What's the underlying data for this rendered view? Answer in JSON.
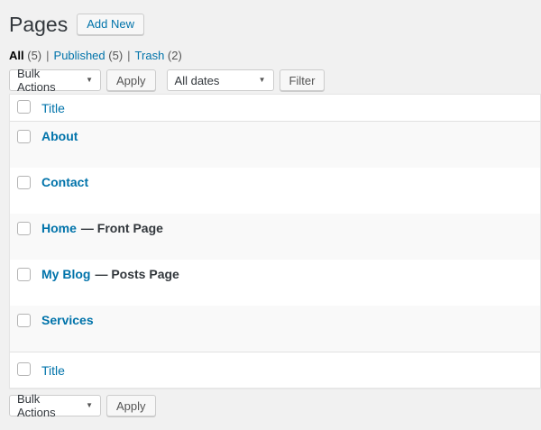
{
  "page": {
    "title": "Pages",
    "add_new_label": "Add New"
  },
  "views": {
    "all_label": "All",
    "all_count": "(5)",
    "published_label": "Published",
    "published_count": "(5)",
    "trash_label": "Trash",
    "trash_count": "(2)",
    "separator": "|"
  },
  "tablenav_top": {
    "bulk_actions_value": "Bulk Actions",
    "apply_label": "Apply",
    "dates_value": "All dates",
    "filter_label": "Filter",
    "dropdown_arrow": "▼"
  },
  "tablenav_bottom": {
    "bulk_actions_value": "Bulk Actions",
    "apply_label": "Apply",
    "dropdown_arrow": "▼"
  },
  "table": {
    "header": {
      "title_column": "Title"
    },
    "footer": {
      "title_column": "Title"
    },
    "rows": [
      {
        "title": "About",
        "state": ""
      },
      {
        "title": "Contact",
        "state": ""
      },
      {
        "title": "Home",
        "state": "— Front Page"
      },
      {
        "title": "My Blog",
        "state": "— Posts Page"
      },
      {
        "title": "Services",
        "state": ""
      }
    ]
  },
  "colors": {
    "accent_link": "#0073aa",
    "page_background": "#f1f1f1",
    "row_stripe": "#f9f9f9",
    "table_border": "#e5e5e5",
    "button_background": "#f7f7f7"
  }
}
